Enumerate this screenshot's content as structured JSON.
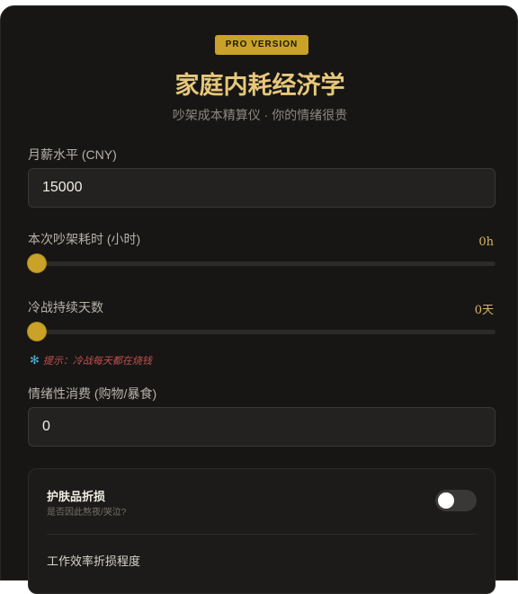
{
  "header": {
    "badge": "PRO VERSION",
    "title": "家庭内耗经济学",
    "subtitle": "吵架成本精算仪 · 你的情绪很贵"
  },
  "salary": {
    "label": "月薪水平 (CNY)",
    "value": "15000"
  },
  "argument_hours": {
    "label": "本次吵架耗时 (小时)",
    "readout": "0h",
    "level": 0
  },
  "cold_war_days": {
    "label": "冷战持续天数",
    "readout": "0天",
    "level": 0,
    "hint_icon": "snowflake-icon",
    "hint": "提示：冷战每天都在烧钱"
  },
  "emotional_spending": {
    "label": "情绪性消费 (购物/暴食)",
    "value": "0"
  },
  "skincare": {
    "title": "护肤品折损",
    "subtitle": "是否因此熬夜/哭泣?",
    "enabled": false
  },
  "efficiency": {
    "label": "工作效率折损程度"
  },
  "colors": {
    "accent": "#c9a227",
    "background": "#171615",
    "title": "#e7c77a",
    "hint": "#c0504d"
  }
}
